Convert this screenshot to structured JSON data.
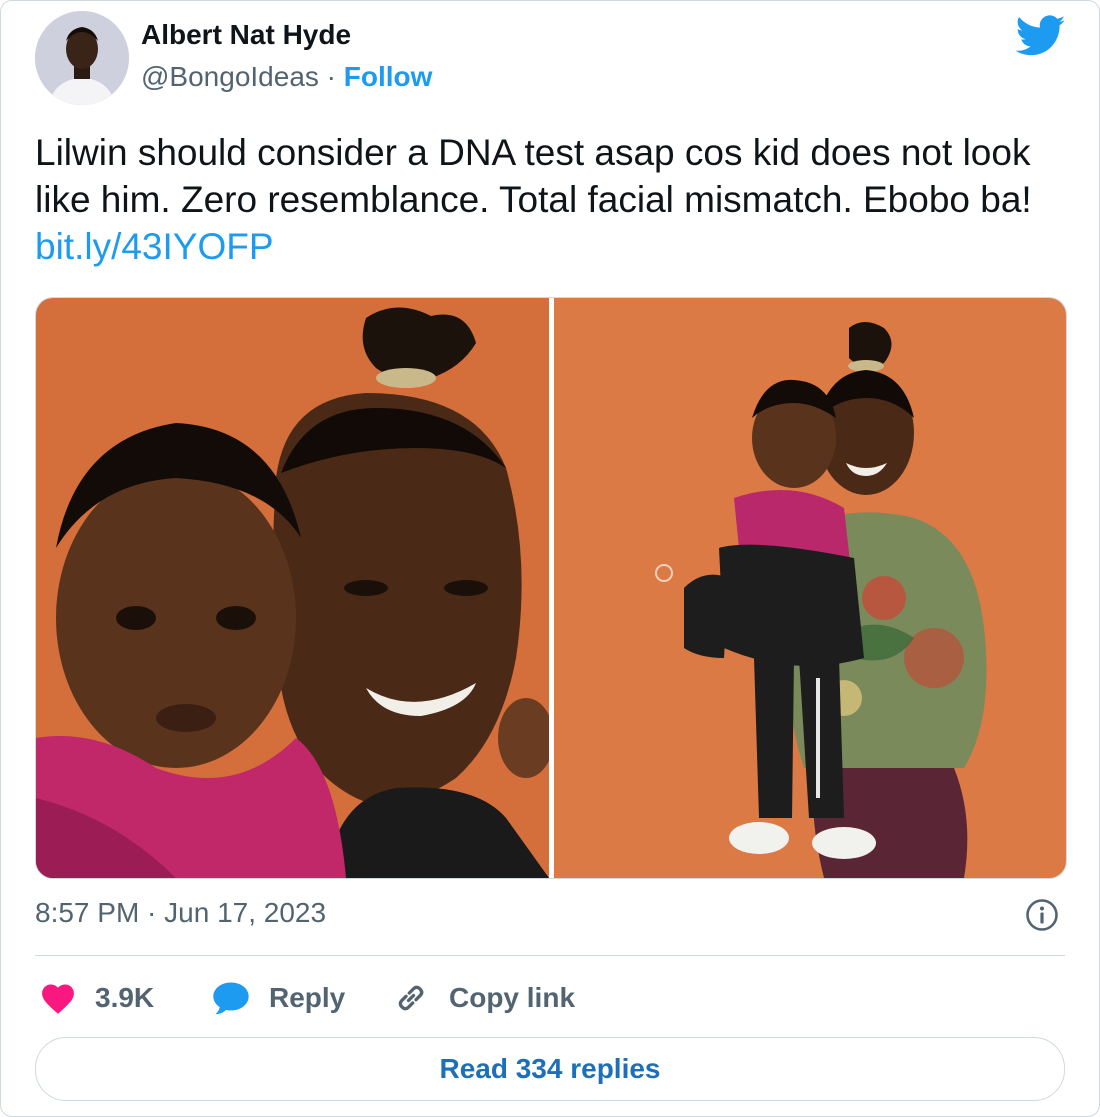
{
  "author": {
    "name": "Albert Nat Hyde",
    "handle": "@BongoIdeas",
    "separator": "·",
    "follow_label": "Follow"
  },
  "tweet": {
    "text": "Lilwin should consider a DNA test asap cos kid does not look like him. Zero resemblance. Total facial mismatch. Ebobo ba! ",
    "link": "bit.ly/43IYOFP"
  },
  "meta": {
    "timestamp": "8:57 PM · Jun 17, 2023"
  },
  "actions": {
    "likes": "3.9K",
    "reply_label": "Reply",
    "copy_link_label": "Copy link",
    "read_replies_label": "Read 334 replies"
  },
  "icons": {
    "brand": "twitter-bird-icon",
    "like": "heart-icon",
    "reply": "speech-bubble-icon",
    "copy": "link-icon",
    "info": "info-icon"
  },
  "colors": {
    "accent": "#1d9bf0",
    "like": "#f91880",
    "text": "#0f1419",
    "muted": "#536471",
    "photo_background": "#d9733f"
  }
}
